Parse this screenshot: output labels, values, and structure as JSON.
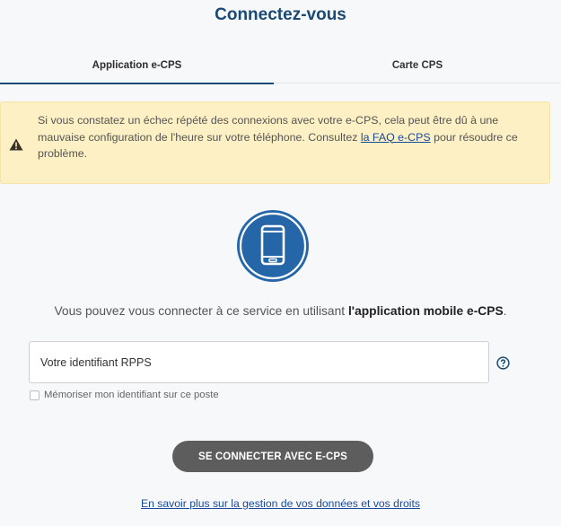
{
  "page": {
    "title": "Connectez-vous"
  },
  "tabs": [
    {
      "label": "Application e-CPS",
      "active": true
    },
    {
      "label": "Carte CPS",
      "active": false
    }
  ],
  "alert": {
    "text_before": "Si vous constatez un échec répété des connexions avec votre e-CPS, cela peut être dû à une mauvaise configuration de l'heure sur votre téléphone. Consultez ",
    "link_label": "la FAQ e-CPS",
    "text_after": " pour résoudre ce problème.",
    "icon": "warning-triangle-icon"
  },
  "phone_icon": {
    "name": "mobile-phone-icon",
    "circle_color": "#2566a8"
  },
  "intro": {
    "text": "Vous pouvez vous connecter à ce service en utilisant ",
    "bold": "l'application mobile e-CPS",
    "end": "."
  },
  "form": {
    "rpps_placeholder": "Votre identifiant RPPS",
    "rpps_value": "",
    "help_icon": "question-circle-icon",
    "remember_label": "Mémoriser mon identifiant sur ce poste",
    "remember_checked": false,
    "connect_label": "SE CONNECTER AVEC E-CPS"
  },
  "footer": {
    "link_label": "En savoir plus sur la gestion de vos données et vos droits"
  },
  "colors": {
    "brand": "#1a4a73",
    "alert_bg": "#fdf0c4",
    "button_bg": "#5d5d5d",
    "link": "#1a4a9b"
  }
}
